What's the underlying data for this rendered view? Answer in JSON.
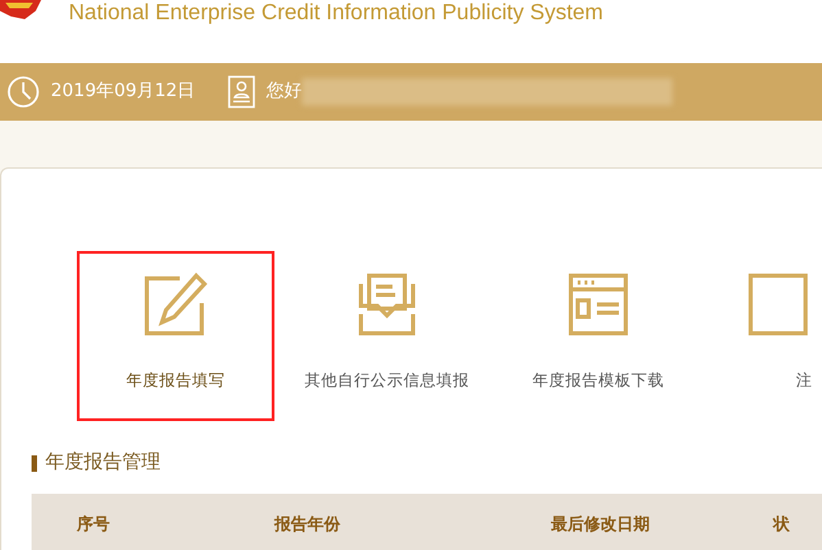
{
  "header": {
    "title": "National Enterprise Credit Information Publicity System"
  },
  "info_bar": {
    "date": "2019年09月12日",
    "greeting": "您好"
  },
  "actions": [
    {
      "label": "年度报告填写",
      "kind": "edit",
      "selected": true
    },
    {
      "label": "其他自行公示信息填报",
      "kind": "inbox",
      "selected": false
    },
    {
      "label": "年度报告模板下载",
      "kind": "template",
      "selected": false
    },
    {
      "label": "注",
      "kind": "cut",
      "selected": false
    }
  ],
  "section": {
    "title": "年度报告管理"
  },
  "table": {
    "columns": [
      "序号",
      "报告年份",
      "最后修改日期",
      "状"
    ]
  }
}
